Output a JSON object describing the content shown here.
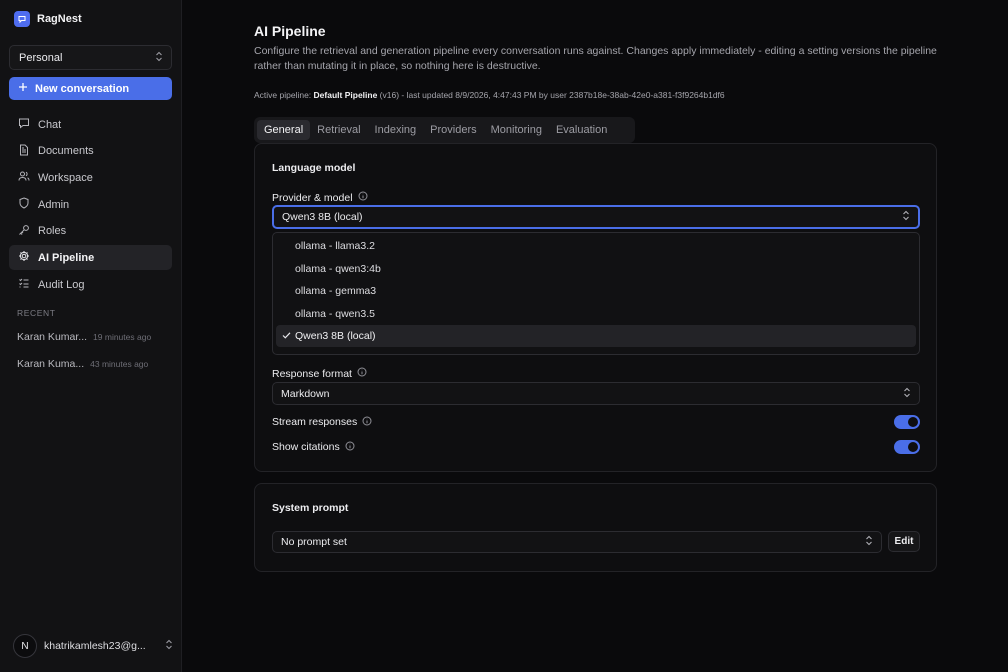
{
  "app": {
    "name": "RagNest",
    "accent": "#4a6ee8"
  },
  "sidebar": {
    "workspace": "Personal",
    "new_conversation": "New conversation",
    "nav": [
      {
        "label": "Chat",
        "icon": "chat-bubble-icon"
      },
      {
        "label": "Documents",
        "icon": "document-icon"
      },
      {
        "label": "Workspace",
        "icon": "users-icon"
      },
      {
        "label": "Admin",
        "icon": "shield-icon"
      },
      {
        "label": "Roles",
        "icon": "key-icon"
      },
      {
        "label": "AI Pipeline",
        "icon": "gear-icon",
        "active": true
      },
      {
        "label": "Audit Log",
        "icon": "list-checks-icon"
      }
    ],
    "recent_label": "RECENT",
    "recent": [
      {
        "title": "Karan Kumar...",
        "time": "19 minutes ago"
      },
      {
        "title": "Karan Kuma...",
        "time": "43 minutes ago"
      }
    ],
    "user": {
      "initial": "N",
      "email": "khatrikamlesh23@g..."
    }
  },
  "main": {
    "title": "AI Pipeline",
    "description": "Configure the retrieval and generation pipeline every conversation runs against. Changes apply immediately - editing a setting versions the pipeline rather than mutating it in place, so nothing here is destructive.",
    "active_prefix": "Active pipeline:",
    "active_name": "Default Pipeline",
    "active_suffix": " (v16) - last updated 8/9/2026, 4:47:43 PM by user 2387b18e-38ab-42e0-a381-f3f9264b1df6",
    "tabs": [
      "General",
      "Retrieval",
      "Indexing",
      "Providers",
      "Monitoring",
      "Evaluation"
    ],
    "language_model": {
      "title": "Language model",
      "provider_label": "Provider & model",
      "provider_value": "Qwen3 8B (local)",
      "options": [
        "ollama - llama3.2",
        "ollama - qwen3:4b",
        "ollama - gemma3",
        "ollama - qwen3.5",
        "Qwen3 8B (local)"
      ],
      "response_format_label": "Response format",
      "response_format_value": "Markdown",
      "stream_label": "Stream responses",
      "stream_on": true,
      "citations_label": "Show citations",
      "citations_on": true
    },
    "system_prompt": {
      "title": "System prompt",
      "value": "No prompt set",
      "edit_label": "Edit"
    }
  }
}
